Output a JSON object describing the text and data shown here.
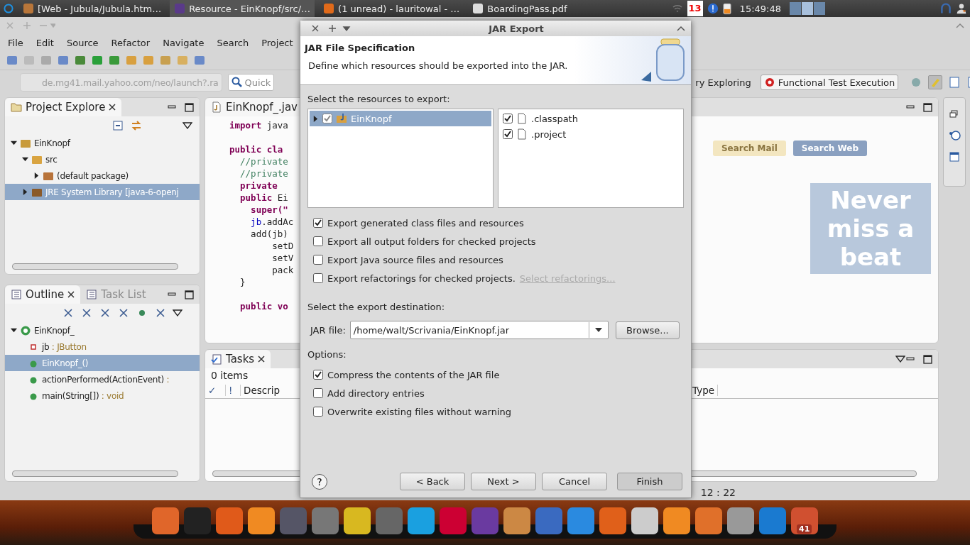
{
  "top_panel": {
    "windows": [
      {
        "title": "[Web - Jubula/Jubula.htm…",
        "selected": false
      },
      {
        "title": "Resource - EinKnopf/src/…",
        "selected": true
      },
      {
        "title": "(1 unread) - lauritowal - …",
        "selected": false
      },
      {
        "title": "BoardingPass.pdf",
        "selected": false
      }
    ],
    "calendar_day": "13",
    "clock": "15:49:48"
  },
  "eclipse": {
    "menu": [
      "File",
      "Edit",
      "Source",
      "Refactor",
      "Navigate",
      "Search",
      "Project"
    ],
    "browser_url": "de.mg41.mail.yahoo.com/neo/launch?.ra",
    "quick_access": "Quick",
    "perspectives": [
      {
        "label": "ry Exploring",
        "selected": false
      },
      {
        "label": "Functional Test Execution",
        "selected": true
      }
    ],
    "project_explorer": {
      "title": "Project Explore",
      "tree": [
        {
          "label": "EinKnopf",
          "kind": "project",
          "expanded": true,
          "selected": false,
          "children": [
            {
              "label": "src",
              "kind": "source",
              "expanded": true,
              "selected": false,
              "children": [
                {
                  "label": "(default package)",
                  "kind": "package",
                  "expanded": false,
                  "selected": false
                }
              ]
            },
            {
              "label": "JRE System Library [java-6-openj",
              "kind": "library",
              "expanded": false,
              "selected": true
            }
          ]
        }
      ]
    },
    "outline": {
      "tabs": [
        {
          "label": "Outline",
          "selected": true
        },
        {
          "label": "Task List",
          "selected": false
        }
      ],
      "tree": [
        {
          "label": "EinKnopf_",
          "kind": "class",
          "expanded": true,
          "selected": false,
          "children": [
            {
              "label": "jb",
              "type": " : JButton",
              "kind": "field",
              "selected": false
            },
            {
              "label": "EinKnopf_()",
              "kind": "constructor",
              "selected": true
            },
            {
              "label": "actionPerformed(ActionEvent)",
              "type": " :",
              "kind": "method",
              "selected": false
            },
            {
              "label": "main(String[])",
              "type": " : void",
              "kind": "method",
              "selected": false
            }
          ]
        }
      ]
    },
    "editor": {
      "tab": "EinKnopf_.jav",
      "lines": [
        {
          "segments": [
            {
              "text": "import",
              "kind": "keyword"
            },
            {
              "text": " java"
            }
          ]
        },
        {
          "blank_before": true,
          "segments": [
            {
              "text": "public cla",
              "kind": "keyword"
            }
          ]
        },
        {
          "segments": [
            {
              "text": "  //private",
              "kind": "comment"
            }
          ]
        },
        {
          "segments": [
            {
              "text": "  //private",
              "kind": "comment"
            }
          ]
        },
        {
          "segments": [
            {
              "text": "  private",
              "kind": "keyword"
            }
          ]
        },
        {
          "segments": [
            {
              "text": "  public",
              "kind": "keyword"
            },
            {
              "text": " Ei"
            }
          ]
        },
        {
          "segments": [
            {
              "text": "    super(\"",
              "kind": "keyword"
            }
          ]
        },
        {
          "segments": [
            {
              "text": "    jb",
              "kind": "field"
            },
            {
              "text": ".addAc"
            }
          ]
        },
        {
          "segments": [
            {
              "text": "    add(jb)"
            }
          ]
        },
        {
          "segments": [
            {
              "text": "        setD"
            }
          ]
        },
        {
          "segments": [
            {
              "text": "        setV"
            }
          ]
        },
        {
          "segments": [
            {
              "text": "        pack"
            }
          ]
        },
        {
          "segments": [
            {
              "text": "  }"
            }
          ]
        },
        {
          "blank_before": true,
          "segments": [
            {
              "text": "  public vo",
              "kind": "keyword"
            }
          ]
        }
      ]
    },
    "tasks": {
      "title": "Tasks",
      "count": "0 items",
      "columns": [
        "✓",
        "!",
        "Descrip",
        "Type"
      ]
    },
    "status": "12 : 22",
    "ghost": {
      "search_buttons": [
        "Search Mail",
        "Search Web"
      ],
      "banner": "Never miss a beat"
    }
  },
  "dialog": {
    "title": "JAR Export",
    "heading": "JAR File Specification",
    "description": "Define which resources should be exported into the JAR.",
    "resources_label": "Select the resources to export:",
    "resources": [
      {
        "label": "EinKnopf",
        "checked": true,
        "expanded": false,
        "selected": true
      }
    ],
    "files": [
      {
        "label": ".classpath",
        "checked": true
      },
      {
        "label": ".project",
        "checked": true
      }
    ],
    "export_options": [
      {
        "label": "Export generated class files and resources",
        "checked": true
      },
      {
        "label": "Export all output folders for checked projects",
        "checked": false
      },
      {
        "label": "Export Java source files and resources",
        "checked": false
      },
      {
        "label": "Export refactorings for checked projects.",
        "checked": false,
        "link": "Select refactorings...",
        "link_disabled": true
      }
    ],
    "destination_label": "Select the export destination:",
    "jar_file_label": "JAR file:",
    "jar_file": "/home/walt/Scrivania/EinKnopf.jar",
    "browse": "Browse...",
    "options_label": "Options:",
    "options": [
      {
        "label": "Compress the contents of the JAR file",
        "checked": true
      },
      {
        "label": "Add directory entries",
        "checked": false
      },
      {
        "label": "Overwrite existing files without warning",
        "checked": false
      }
    ],
    "help": "?",
    "buttons": [
      {
        "label": "< Back",
        "disabled": false
      },
      {
        "label": "Next >",
        "disabled": false
      },
      {
        "label": "Cancel",
        "disabled": false
      },
      {
        "label": "Finish",
        "disabled": false
      }
    ]
  },
  "dock": {
    "badge": "41"
  }
}
